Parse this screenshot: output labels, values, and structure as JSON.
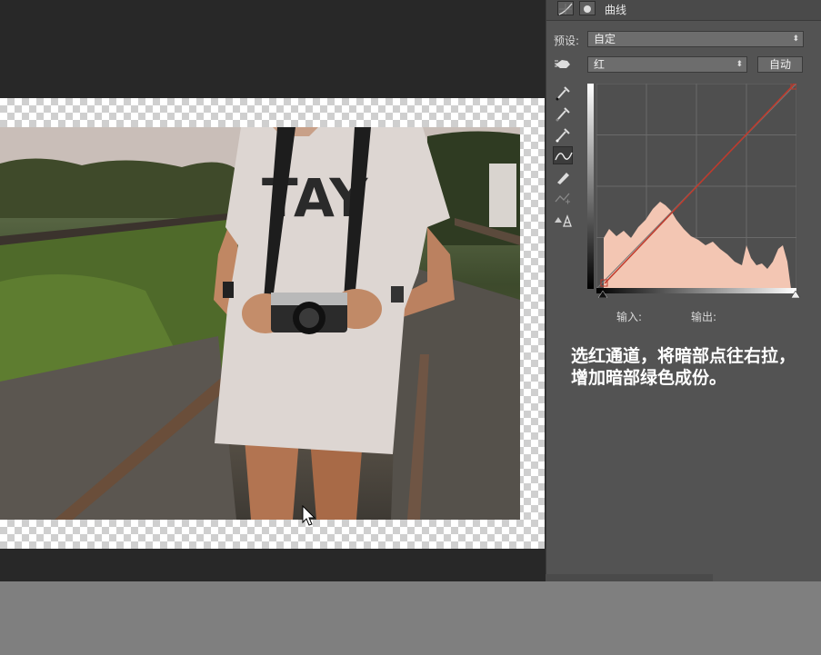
{
  "panel": {
    "title": "曲线",
    "preset_label": "预设:",
    "preset_value": "自定",
    "channel_value": "红",
    "auto_button": "自动",
    "input_label": "输入:",
    "output_label": "输出:"
  },
  "photo": {
    "shirt_text": "TAY"
  },
  "annotation": {
    "text": "选红通道，将暗部点往右拉，增加暗部绿色成份。"
  },
  "colors": {
    "histogram_fill": "#f3c6b3",
    "curve_line": "#c0392b"
  },
  "icons": [
    "curves-icon",
    "mask-icon",
    "hand-adjust-icon",
    "eyedropper-black-icon",
    "eyedropper-gray-icon",
    "eyedropper-white-icon",
    "curve-tool-icon",
    "pencil-icon",
    "smooth-icon",
    "clipping-warning-icon",
    "mouse-cursor-icon"
  ]
}
